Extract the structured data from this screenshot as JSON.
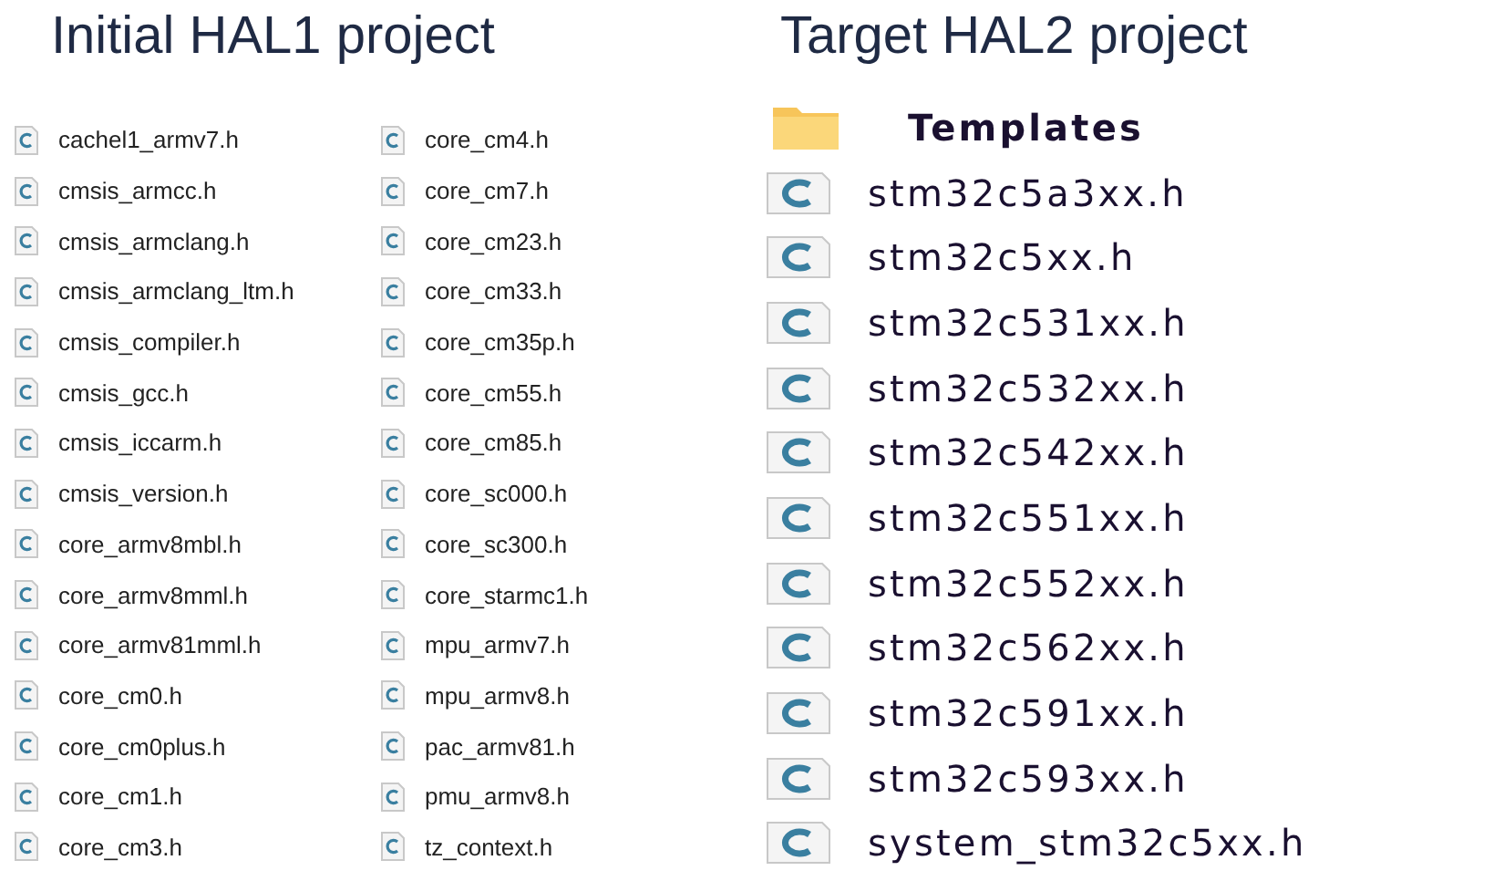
{
  "panels": [
    {
      "title": "Initial HAL1 project",
      "columns": [
        [
          {
            "kind": "file",
            "name": "cachel1_armv7.h"
          },
          {
            "kind": "file",
            "name": "cmsis_armcc.h"
          },
          {
            "kind": "file",
            "name": "cmsis_armclang.h"
          },
          {
            "kind": "file",
            "name": "cmsis_armclang_ltm.h"
          },
          {
            "kind": "file",
            "name": "cmsis_compiler.h"
          },
          {
            "kind": "file",
            "name": "cmsis_gcc.h"
          },
          {
            "kind": "file",
            "name": "cmsis_iccarm.h"
          },
          {
            "kind": "file",
            "name": "cmsis_version.h"
          },
          {
            "kind": "file",
            "name": "core_armv8mbl.h"
          },
          {
            "kind": "file",
            "name": "core_armv8mml.h"
          },
          {
            "kind": "file",
            "name": "core_armv81mml.h"
          },
          {
            "kind": "file",
            "name": "core_cm0.h"
          },
          {
            "kind": "file",
            "name": "core_cm0plus.h"
          },
          {
            "kind": "file",
            "name": "core_cm1.h"
          },
          {
            "kind": "file",
            "name": "core_cm3.h"
          }
        ],
        [
          {
            "kind": "file",
            "name": "core_cm4.h"
          },
          {
            "kind": "file",
            "name": "core_cm7.h"
          },
          {
            "kind": "file",
            "name": "core_cm23.h"
          },
          {
            "kind": "file",
            "name": "core_cm33.h"
          },
          {
            "kind": "file",
            "name": "core_cm35p.h"
          },
          {
            "kind": "file",
            "name": "core_cm55.h"
          },
          {
            "kind": "file",
            "name": "core_cm85.h"
          },
          {
            "kind": "file",
            "name": "core_sc000.h"
          },
          {
            "kind": "file",
            "name": "core_sc300.h"
          },
          {
            "kind": "file",
            "name": "core_starmc1.h"
          },
          {
            "kind": "file",
            "name": "mpu_armv7.h"
          },
          {
            "kind": "file",
            "name": "mpu_armv8.h"
          },
          {
            "kind": "file",
            "name": "pac_armv81.h"
          },
          {
            "kind": "file",
            "name": "pmu_armv8.h"
          },
          {
            "kind": "file",
            "name": "tz_context.h"
          }
        ]
      ]
    },
    {
      "title": "Target HAL2 project",
      "columns": [
        [
          {
            "kind": "folder",
            "name": "Templates"
          },
          {
            "kind": "file",
            "name": "stm32c5a3xx.h"
          },
          {
            "kind": "file",
            "name": "stm32c5xx.h"
          },
          {
            "kind": "file",
            "name": "stm32c531xx.h"
          },
          {
            "kind": "file",
            "name": "stm32c532xx.h"
          },
          {
            "kind": "file",
            "name": "stm32c542xx.h"
          },
          {
            "kind": "file",
            "name": "stm32c551xx.h"
          },
          {
            "kind": "file",
            "name": "stm32c552xx.h"
          },
          {
            "kind": "file",
            "name": "stm32c562xx.h"
          },
          {
            "kind": "file",
            "name": "stm32c591xx.h"
          },
          {
            "kind": "file",
            "name": "stm32c593xx.h"
          },
          {
            "kind": "file",
            "name": "system_stm32c5xx.h"
          }
        ]
      ]
    }
  ]
}
